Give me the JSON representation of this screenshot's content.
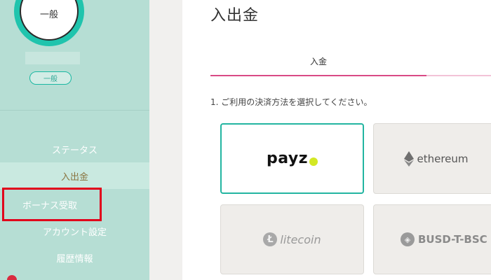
{
  "sidebar": {
    "avatar_label": "一般",
    "rank_badge": "一般",
    "nav": [
      {
        "label": "ステータス"
      },
      {
        "label": "入出金"
      },
      {
        "label": "ボーナス受取"
      },
      {
        "label": "アカウント設定"
      },
      {
        "label": "履歴情報"
      }
    ]
  },
  "main": {
    "title": "入出金",
    "tabs": [
      {
        "label": "入金"
      }
    ],
    "instruction": "1. ご利用の決済方法を選択してください。",
    "payment_methods": [
      {
        "label": "payz",
        "selected": true
      },
      {
        "label": "ethereum",
        "selected": false
      },
      {
        "label": "litecoin",
        "selected": false
      },
      {
        "label": "BUSD-T-BSC",
        "selected": false
      }
    ]
  },
  "colors": {
    "sidebar_bg": "#b6ded4",
    "accent_teal": "#23b5a1",
    "tab_underline": "#d94a85",
    "highlight_red": "#e1001b",
    "payz_dot": "#d3e824"
  },
  "icons": {
    "ethereum": "ethereum-diamond-icon",
    "litecoin": "litecoin-L-icon",
    "busd": "busd-icon"
  }
}
